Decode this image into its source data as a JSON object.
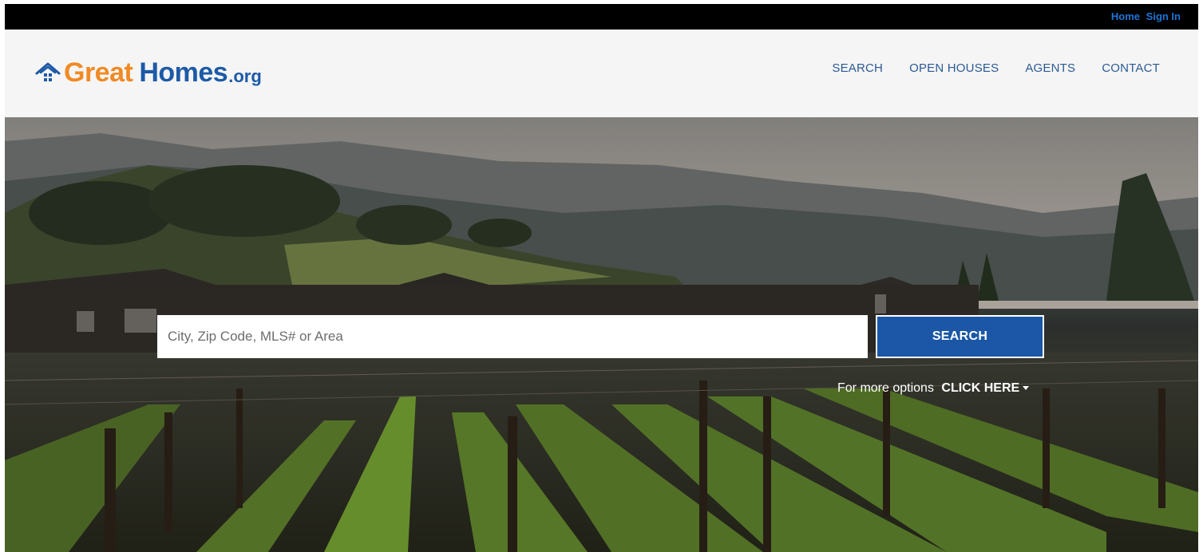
{
  "topbar": {
    "links": [
      "Home",
      "Sign In"
    ]
  },
  "logo": {
    "part1": "Great",
    "part2": "Homes",
    "suffix": ".org",
    "icon": "house-icon"
  },
  "nav": {
    "items": [
      "SEARCH",
      "OPEN HOUSES",
      "AGENTS",
      "CONTACT"
    ]
  },
  "hero": {
    "search_placeholder": "City, Zip Code, MLS# or Area",
    "search_button": "SEARCH",
    "more_text": "For more options",
    "more_link": "CLICK HERE"
  },
  "colors": {
    "topbar_bg": "#000000",
    "topbar_link": "#1e74d8",
    "logo_orange": "#f08a24",
    "logo_blue": "#1d5aa6",
    "nav_text": "#2b5a93",
    "button_bg": "#1b57a6"
  }
}
